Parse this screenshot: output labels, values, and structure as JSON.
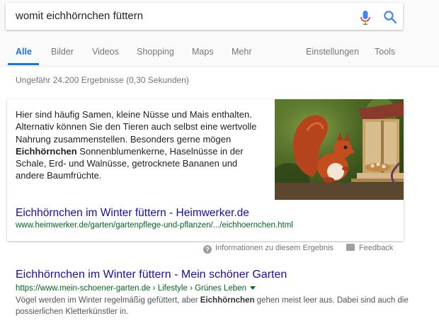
{
  "search": {
    "query": "womit eichhörnchen füttern",
    "mic_icon": "microphone-icon",
    "search_icon": "search-icon"
  },
  "tabs": [
    {
      "label": "Alle",
      "active": true
    },
    {
      "label": "Bilder"
    },
    {
      "label": "Videos"
    },
    {
      "label": "Shopping"
    },
    {
      "label": "Maps"
    },
    {
      "label": "Mehr"
    },
    {
      "label": "Einstellungen"
    },
    {
      "label": "Tools"
    }
  ],
  "result_stats": "Ungefähr 24.200 Ergebnisse (0,30 Sekunden)",
  "featured_snippet": {
    "text_before": "Hier sind häufig Samen, kleine Nüsse und Mais enthalten. Alternativ können Sie den Tieren auch selbst eine wertvolle Nahrung zusammenstellen. Besonders gerne mögen ",
    "text_bold": "Eichhörnchen",
    "text_after": " Sonnenblumenkerne, Haselnüsse in der Schale, Erd- und Walnüsse, getrocknete Bananen und andere Baumfrüchte.",
    "image": "red-squirrel-at-feeder",
    "title": "Eichhörnchen im Winter füttern - Heimwerker.de",
    "url": "www.heimwerker.de/garten/gartenpflege-und-pflanzen/.../eichhoernchen.html"
  },
  "info_row": {
    "about_label": "Informationen zu diesem Ergebnis",
    "feedback_label": "Feedback"
  },
  "result": {
    "title": "Eichhörnchen im Winter füttern - Mein schöner Garten",
    "url": "https://www.mein-schoener-garten.de › Lifestyle › Grünes Leben",
    "desc_before": "Vögel werden im Winter regelmäßig gefüttert, aber ",
    "desc_bold": "Eichhörnchen",
    "desc_after": " gehen meist leer aus. Dabei sind auch die possierlichen Kletterkünstler in."
  },
  "colors": {
    "accent": "#1a73e8",
    "link": "#1a0dab",
    "url": "#006621"
  }
}
